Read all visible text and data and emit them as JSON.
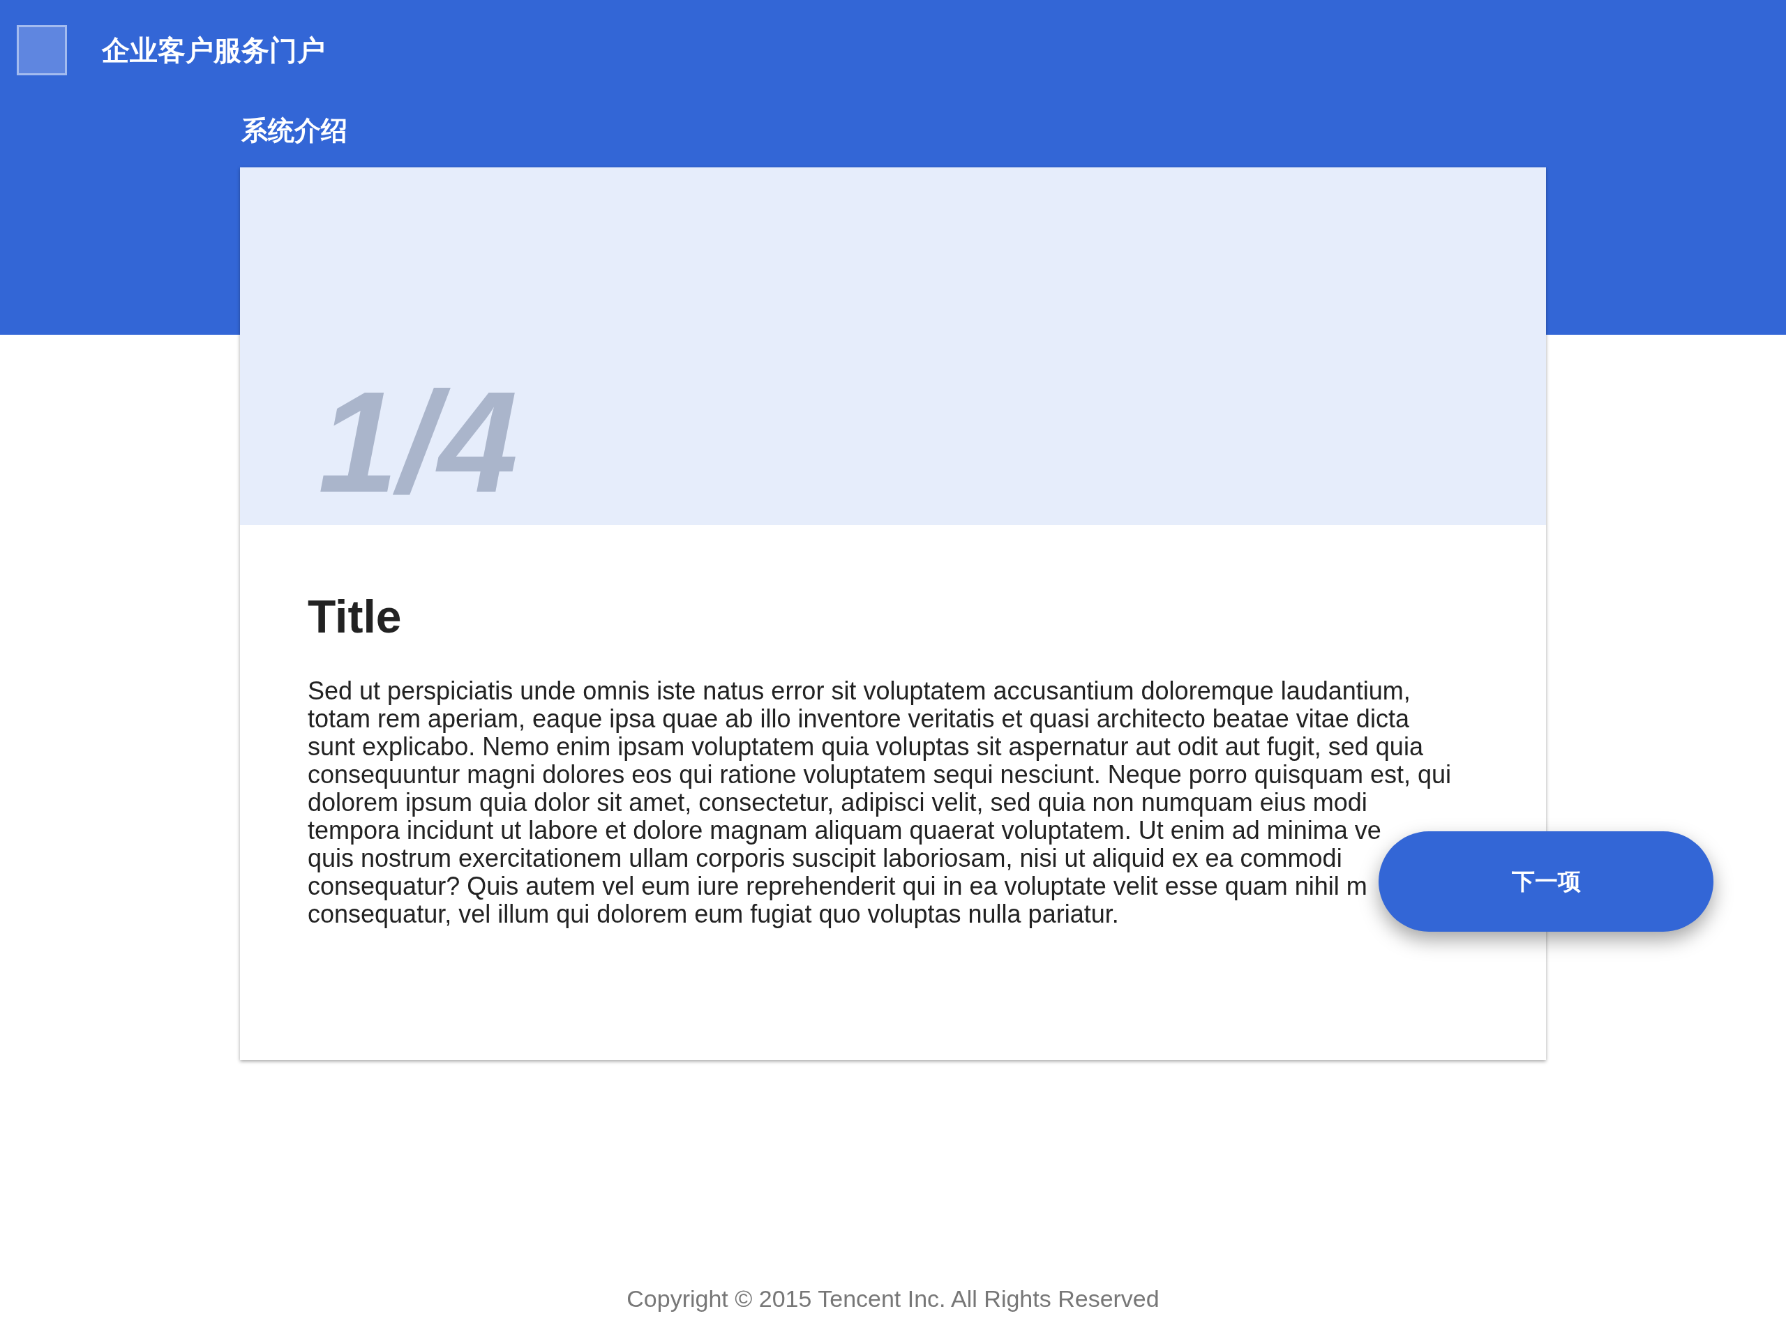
{
  "header": {
    "title": "企业客户服务门户"
  },
  "section": {
    "title": "系统介绍"
  },
  "card": {
    "counter": "1/4",
    "title": "Title",
    "body_lines": [
      "Sed ut perspiciatis unde omnis iste natus error sit voluptatem accusantium doloremque laudantium,",
      "totam rem aperiam, eaque ipsa quae ab illo inventore veritatis et quasi architecto beatae vitae dicta",
      "sunt explicabo. Nemo enim ipsam voluptatem quia voluptas sit aspernatur aut odit aut fugit, sed quia",
      "consequuntur magni dolores eos qui ratione voluptatem sequi nesciunt. Neque porro quisquam est, qui",
      "dolorem ipsum quia dolor sit amet, consectetur, adipisci velit, sed quia non numquam eius modi",
      "tempora incidunt ut labore et dolore magnam aliquam quaerat voluptatem. Ut enim ad minima ve",
      "quis nostrum exercitationem ullam corporis suscipit laboriosam, nisi ut aliquid ex ea commodi",
      "consequatur? Quis autem vel eum iure reprehenderit qui in ea voluptate velit esse quam nihil m",
      "consequatur, vel illum qui dolorem eum fugiat quo voluptas nulla pariatur."
    ]
  },
  "next_button": {
    "label": "下一项"
  },
  "footer": {
    "copyright": "Copyright © 2015 Tencent Inc. All Rights Reserved"
  }
}
